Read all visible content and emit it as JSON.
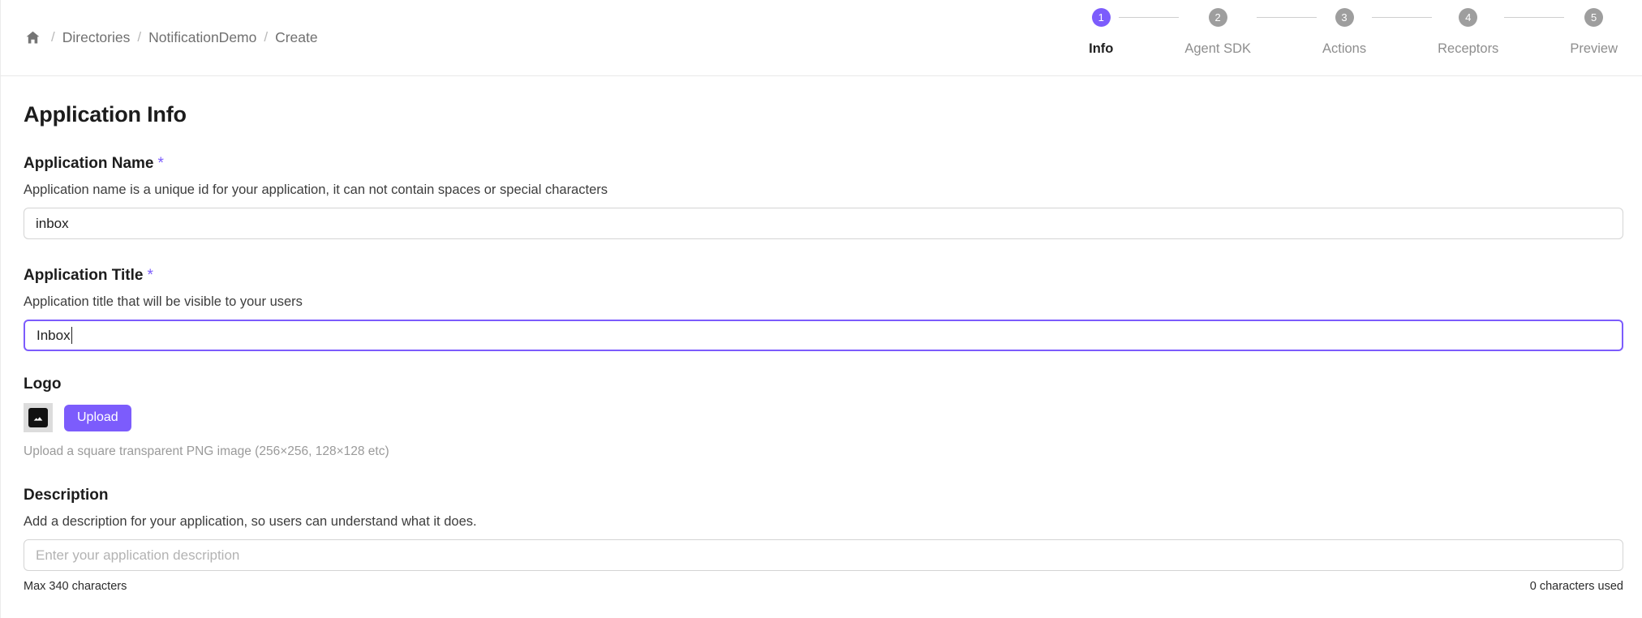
{
  "breadcrumb": {
    "home_icon": "home-icon",
    "separator": "/",
    "items": [
      {
        "label": "Directories"
      },
      {
        "label": "NotificationDemo"
      },
      {
        "label": "Create"
      }
    ]
  },
  "stepper": {
    "active_color": "#7c5cfc",
    "inactive_color": "#9e9e9e",
    "steps": [
      {
        "number": "1",
        "label": "Info",
        "active": true
      },
      {
        "number": "2",
        "label": "Agent SDK",
        "active": false
      },
      {
        "number": "3",
        "label": "Actions",
        "active": false
      },
      {
        "number": "4",
        "label": "Receptors",
        "active": false
      },
      {
        "number": "5",
        "label": "Preview",
        "active": false
      }
    ]
  },
  "main": {
    "page_title": "Application Info",
    "application_name": {
      "label": "Application Name",
      "required_marker": "*",
      "hint": "Application name is a unique id for your application, it can not contain spaces or special characters",
      "value": "inbox",
      "placeholder": ""
    },
    "application_title": {
      "label": "Application Title",
      "required_marker": "*",
      "hint": "Application title that will be visible to your users",
      "value": "Inbox",
      "placeholder": "",
      "focused": true
    },
    "logo": {
      "label": "Logo",
      "thumbnail_icon": "image-placeholder-icon",
      "upload_label": "Upload",
      "note": "Upload a square transparent PNG image (256×256, 128×128 etc)"
    },
    "description": {
      "label": "Description",
      "hint": "Add a description for your application, so users can understand what it does.",
      "value": "",
      "placeholder": "Enter your application description",
      "max_note": "Max 340 characters",
      "used_note": "0 characters used"
    }
  }
}
